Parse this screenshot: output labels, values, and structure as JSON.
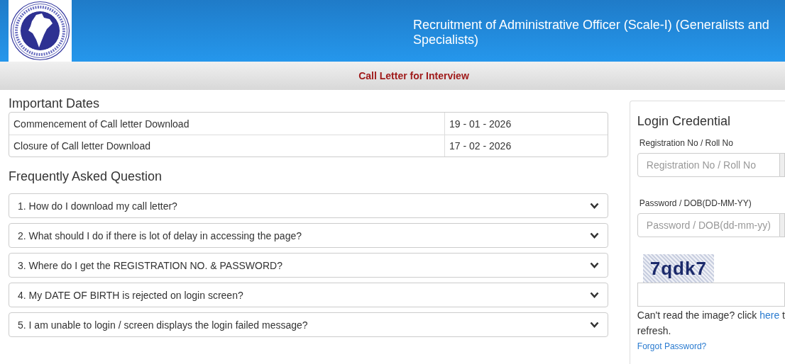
{
  "header": {
    "title": "Recruitment of Administrative Officer (Scale-I) (Generalists and Specialists)"
  },
  "subheader": "Call Letter for Interview",
  "important_dates": {
    "title": "Important Dates",
    "rows": [
      {
        "label": "Commencement of Call letter Download",
        "date": "19 - 01 - 2026"
      },
      {
        "label": "Closure of Call letter Download",
        "date": "17 - 02 - 2026"
      }
    ]
  },
  "faq": {
    "title": "Frequently Asked Question",
    "items": [
      {
        "question": "1. How do I download my call letter?",
        "expanded": false
      },
      {
        "question": "2. What should I do if there is lot of delay in accessing the page?",
        "expanded": false
      },
      {
        "question": "3. Where do I get the REGISTRATION NO. & PASSWORD?",
        "expanded": false
      },
      {
        "question": "4. My DATE OF BIRTH is rejected on login screen?",
        "expanded": false
      },
      {
        "question": "5. I am unable to login / screen displays the login failed message?",
        "expanded": false
      }
    ]
  },
  "login": {
    "title": "Login Credential",
    "fields": [
      {
        "label": "Registration No / Roll No",
        "placeholder": "Registration No / Roll No"
      },
      {
        "label": "Password / DOB(DD-MM-YY)",
        "placeholder": "Password / DOB(dd-mm-yy)"
      }
    ],
    "captcha": "7qdk7",
    "captcha_hint": {
      "before": "Can't read the image? click ",
      "link": "here",
      "after": " t",
      "next_line": "refresh."
    },
    "forgot": "Forgot Password?"
  }
}
